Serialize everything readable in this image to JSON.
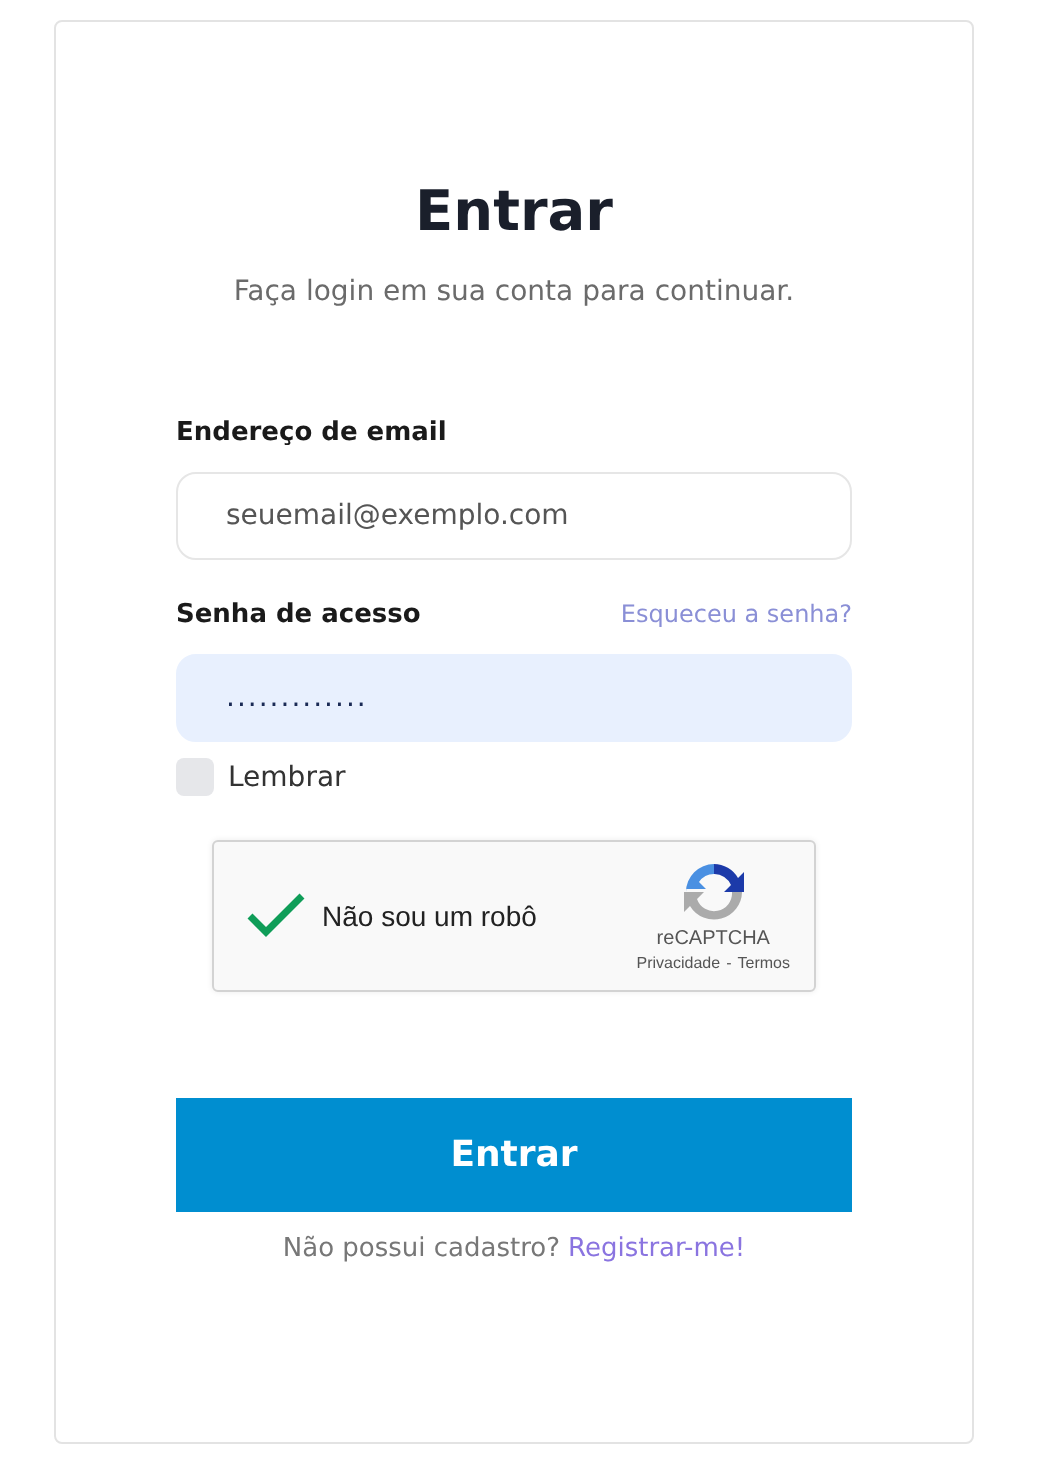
{
  "title": "Entrar",
  "subtitle": "Faça login em sua conta para continuar.",
  "email": {
    "label": "Endereço de email",
    "placeholder": "seuemail@exemplo.com"
  },
  "password": {
    "label": "Senha de acesso",
    "forgot_link": "Esqueceu a senha?",
    "value": "............."
  },
  "remember": {
    "label": "Lembrar",
    "checked": false
  },
  "captcha": {
    "label": "Não sou um robô",
    "checked": true,
    "brand": "reCAPTCHA",
    "privacy": "Privacidade",
    "separator": "-",
    "terms": "Termos"
  },
  "submit": "Entrar",
  "footer": {
    "text": "Não possui cadastro?",
    "link": "Registrar-me!"
  }
}
